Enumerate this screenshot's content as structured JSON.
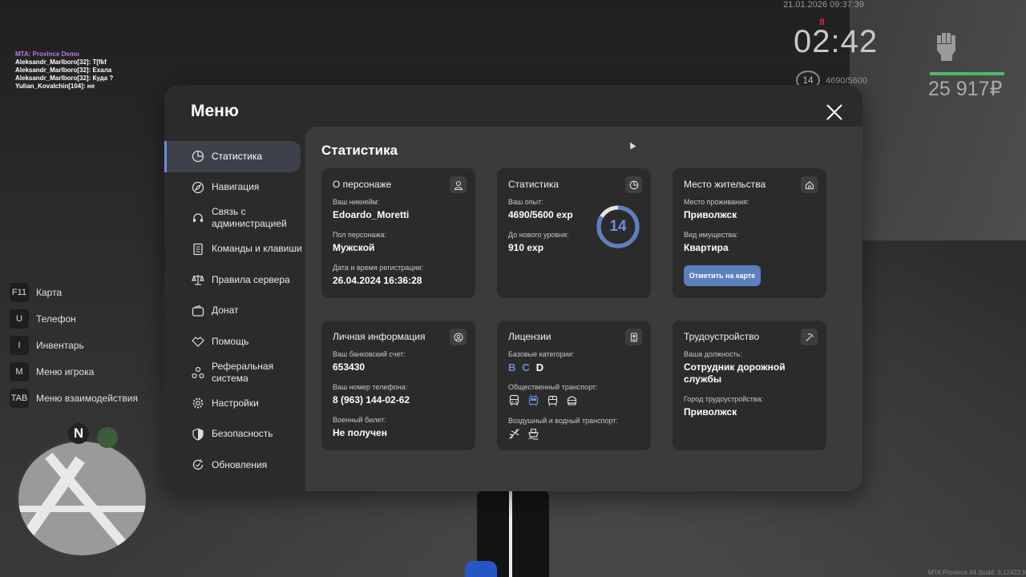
{
  "hud": {
    "datetime": "21.01.2026 09:37:39",
    "clock": "02:42",
    "level": "14",
    "exp": "4690/5600",
    "money": "25 917₽",
    "health_bar_color": "#4fb86a",
    "money_color": "#aaaaaa"
  },
  "chat": {
    "title": "MTA: Province Demo",
    "lines": [
      "Aleksandr_Marlboro[32]: T[fkf",
      "Aleksandr_Marlboro[32]: Ехала",
      "Aleksandr_Marlboro[32]: Куда ?",
      "Yulian_Kovalchin[104]: не"
    ]
  },
  "keybinds": [
    {
      "key": "F11",
      "label": "Карта"
    },
    {
      "key": "U",
      "label": "Телефон"
    },
    {
      "key": "I",
      "label": "Инвентарь"
    },
    {
      "key": "M",
      "label": "Меню игрока"
    },
    {
      "key": "TAB",
      "label": "Меню взаимодействия"
    }
  ],
  "minimap": {
    "north": "N"
  },
  "build": "MTA Province #4 (build: 6.12422.9",
  "menu": {
    "title": "Меню",
    "accent_color": "#6c8fd6",
    "sidebar": [
      {
        "label": "Статистика",
        "icon": "pie-chart-icon",
        "active": true
      },
      {
        "label": "Навигация",
        "icon": "compass-icon"
      },
      {
        "label": "Связь с администрацией",
        "icon": "headset-icon"
      },
      {
        "label": "Команды и клавиши",
        "icon": "document-icon"
      },
      {
        "label": "Правила сервера",
        "icon": "scales-icon"
      },
      {
        "label": "Донат",
        "icon": "wallet-icon"
      },
      {
        "label": "Помощь",
        "icon": "handshake-icon"
      },
      {
        "label": "Реферальная система",
        "icon": "referral-icon"
      },
      {
        "label": "Настройки",
        "icon": "gear-icon"
      },
      {
        "label": "Безопасность",
        "icon": "shield-icon"
      },
      {
        "label": "Обновления",
        "icon": "refresh-icon"
      }
    ],
    "content_title": "Статистика",
    "cards": {
      "character": {
        "title": "О персонаже",
        "icon": "user-icon",
        "nickname_label": "Ваш никнейм:",
        "nickname": "Edoardo_Moretti",
        "gender_label": "Пол персонажа:",
        "gender": "Мужской",
        "reg_label": "Дата и время регистрации:",
        "reg": "26.04.2024 16:36:28"
      },
      "stats": {
        "title": "Статистика",
        "icon": "pie-chart-icon",
        "exp_label": "Ваш опыт:",
        "exp": "4690/5600 exp",
        "next_label": "До нового уровня:",
        "next": "910 exp",
        "level": "14",
        "level_progress": 0.8375
      },
      "residence": {
        "title": "Место жительства",
        "icon": "home-icon",
        "city_label": "Место проживания:",
        "city": "Приволжск",
        "type_label": "Вид имущества:",
        "type": "Квартира",
        "button": "Отметить на карте"
      },
      "personal": {
        "title": "Личная информация",
        "icon": "user-circle-icon",
        "bank_label": "Ваш банковский счет:",
        "bank": "653430",
        "phone_label": "Ваш номер телефона:",
        "phone": "8 (963) 144-02-62",
        "military_label": "Военный билет:",
        "military": "Не получен"
      },
      "licenses": {
        "title": "Лицензии",
        "icon": "id-card-icon",
        "base_label": "Базовые категории:",
        "categories": [
          "B",
          "C",
          "D"
        ],
        "public_label": "Общественный транспорт:",
        "public_icons": [
          "bus-icon",
          "trolleybus-icon",
          "tram-icon",
          "metro-icon"
        ],
        "air_label": "Воздушный и водный транспорт:",
        "air_icons": [
          "airplane-icon",
          "ship-icon"
        ]
      },
      "job": {
        "title": "Трудоустройство",
        "icon": "pickaxe-icon",
        "position_label": "Ваша должность:",
        "position": "Сотрудник дорожной службы",
        "city_label": "Город трудоустройства:",
        "city": "Приволжск"
      }
    }
  }
}
